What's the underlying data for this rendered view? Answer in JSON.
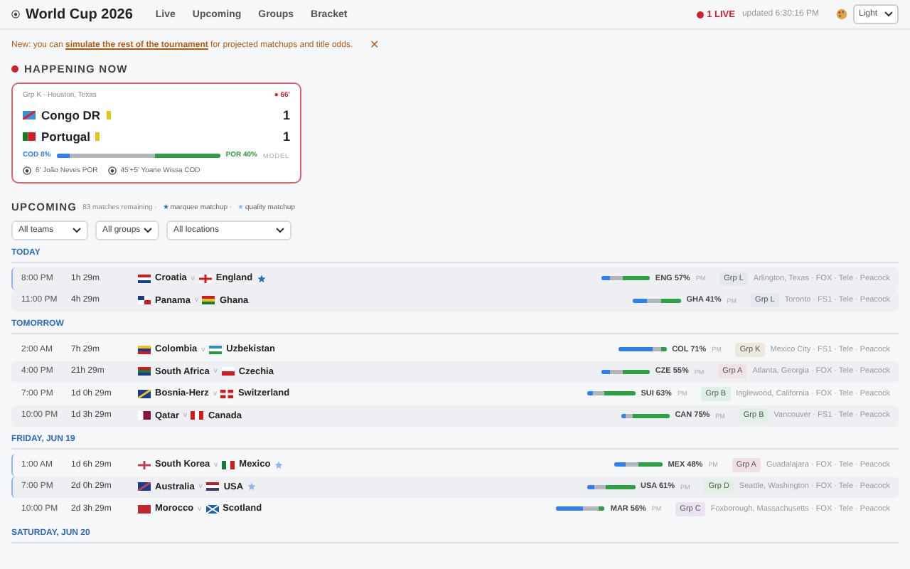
{
  "header": {
    "title": "World Cup 2026",
    "nav": [
      {
        "label": "Live",
        "selected": false
      },
      {
        "label": "Upcoming",
        "selected": false
      },
      {
        "label": "Groups",
        "selected": false
      },
      {
        "label": "Bracket",
        "selected": false
      }
    ],
    "live_count": "1 LIVE",
    "updated": "updated 6:30:16 PM",
    "theme": "Light"
  },
  "banner": {
    "text": "New: you can **simulate the rest of the tournament** for projected matchups and title odds.",
    "close": "✕"
  },
  "happening_now": {
    "title": "HAPPENING NOW",
    "match": {
      "info": "Grp K · Houston, Texas",
      "minute": "● 66'",
      "teams": [
        {
          "name": "Congo DR",
          "kind": "cd",
          "booked": true,
          "score": "1"
        },
        {
          "name": "Portugal",
          "kind": "pt",
          "booked": true,
          "score": "1"
        }
      ],
      "odds": {
        "home_label": "COD 8%",
        "away_label": "POR 40%",
        "home": {
          "level": 0.08
        },
        "away": {
          "level": 0.4
        },
        "model": "MODEL"
      },
      "events": [
        "6' João Neves POR",
        "45'+5' Yoane Wissa COD"
      ]
    }
  },
  "upcoming": {
    "title": "UPCOMING",
    "remaining": "83 matches remaining ·",
    "marquee": "★ marquee matchup ·",
    "quality": "★ quality matchup",
    "filters": [
      "All teams",
      "All groups",
      "All locations"
    ],
    "days": [
      {
        "label": "TODAY",
        "matches": [
          {
            "time": "8:00 PM",
            "countdown": "1h 29m",
            "home": {
              "name": "Croatia",
              "kind": "hr"
            },
            "versus": "v",
            "away": {
              "name": "England",
              "kind": "en"
            },
            "marquee": true,
            "quality": false,
            "odds": {
              "home": {
                "level": 0.18
              },
              "away": {
                "level": 0.57
              }
            },
            "pick": "ENG 57%",
            "pm": "PM",
            "group": {
              "label": "Grp L",
              "color": "#e3e8ee"
            },
            "venue": "Arlington, Texas · FOX · Tele · Peacock"
          },
          {
            "time": "11:00 PM",
            "countdown": "4h 29m",
            "home": {
              "name": "Panama",
              "kind": "pa"
            },
            "versus": "v",
            "away": {
              "name": "Ghana",
              "kind": "gh"
            },
            "marquee": false,
            "quality": false,
            "odds": {
              "home": {
                "level": 0.3
              },
              "away": {
                "level": 0.41
              }
            },
            "pick": "GHA 41%",
            "pm": "PM",
            "group": {
              "label": "Grp L",
              "color": "#e3e8ee"
            },
            "venue": "Toronto · FS1 · Tele · Peacock"
          }
        ]
      },
      {
        "label": "TOMORROW",
        "matches": [
          {
            "time": "2:00 AM",
            "countdown": "7h 29m",
            "home": {
              "name": "Colombia",
              "kind": "co"
            },
            "versus": "v",
            "away": {
              "name": "Uzbekistan",
              "kind": "uz"
            },
            "marquee": false,
            "quality": false,
            "odds": {
              "home": {
                "level": 0.71
              },
              "away": {
                "level": 0.1
              }
            },
            "pick": "COL 71%",
            "pm": "PM",
            "group": {
              "label": "Grp K",
              "color": "#ece9dc"
            },
            "venue": "Mexico City · FS1 · Tele · Peacock"
          },
          {
            "time": "4:00 PM",
            "countdown": "21h 29m",
            "home": {
              "name": "South Africa",
              "kind": "za"
            },
            "versus": "v",
            "away": {
              "name": "Czechia",
              "kind": "cz"
            },
            "marquee": false,
            "quality": false,
            "odds": {
              "home": {
                "level": 0.17
              },
              "away": {
                "level": 0.55
              }
            },
            "pick": "CZE 55%",
            "pm": "PM",
            "group": {
              "label": "Grp A",
              "color": "#f1e1e4"
            },
            "venue": "Atlanta, Georgia · FOX · Tele · Peacock"
          },
          {
            "time": "7:00 PM",
            "countdown": "1d 0h 29m",
            "home": {
              "name": "Bosnia-Herz",
              "kind": "ba"
            },
            "versus": "v",
            "away": {
              "name": "Switzerland",
              "kind": "ch"
            },
            "marquee": false,
            "quality": false,
            "odds": {
              "home": {
                "level": 0.12
              },
              "away": {
                "level": 0.63
              }
            },
            "pick": "SUI 63%",
            "pm": "PM",
            "group": {
              "label": "Grp B",
              "color": "#dff0e6"
            },
            "venue": "Inglewood, California · FOX · Tele · Peacock"
          },
          {
            "time": "10:00 PM",
            "countdown": "1d 3h 29m",
            "home": {
              "name": "Qatar",
              "kind": "qa"
            },
            "versus": "v",
            "away": {
              "name": "Canada",
              "kind": "ca"
            },
            "marquee": false,
            "quality": false,
            "odds": {
              "home": {
                "level": 0.1
              },
              "away": {
                "level": 0.75
              }
            },
            "pick": "CAN 75%",
            "pm": "PM",
            "group": {
              "label": "Grp B",
              "color": "#dff0e6"
            },
            "venue": "Vancouver · FS1 · Tele · Peacock"
          }
        ]
      },
      {
        "label": "FRIDAY, JUN 19",
        "matches": [
          {
            "time": "1:00 AM",
            "countdown": "1d 6h 29m",
            "home": {
              "name": "South Korea",
              "kind": "kr"
            },
            "versus": "v",
            "away": {
              "name": "Mexico",
              "kind": "mx"
            },
            "marquee": false,
            "quality": true,
            "odds": {
              "home": {
                "level": 0.25
              },
              "away": {
                "level": 0.48
              }
            },
            "pick": "MEX 48%",
            "pm": "PM",
            "group": {
              "label": "Grp A",
              "color": "#f1e1e4"
            },
            "venue": "Guadalajara · FOX · Tele · Peacock"
          },
          {
            "time": "7:00 PM",
            "countdown": "2d 0h 29m",
            "home": {
              "name": "Australia",
              "kind": "au"
            },
            "versus": "v",
            "away": {
              "name": "USA",
              "kind": "us"
            },
            "marquee": false,
            "quality": true,
            "odds": {
              "home": {
                "level": 0.17
              },
              "away": {
                "level": 0.61
              }
            },
            "pick": "USA 61%",
            "pm": "PM",
            "group": {
              "label": "Grp D",
              "color": "#e2f0e2"
            },
            "venue": "Seattle, Washington · FOX · Tele · Peacock"
          },
          {
            "time": "10:00 PM",
            "countdown": "2d 3h 29m",
            "home": {
              "name": "Morocco",
              "kind": "ma"
            },
            "versus": "v",
            "away": {
              "name": "Scotland",
              "kind": "sc"
            },
            "marquee": false,
            "quality": false,
            "odds": {
              "home": {
                "level": 0.56
              },
              "away": {
                "level": 0.14
              }
            },
            "pick": "MAR 56%",
            "pm": "PM",
            "group": {
              "label": "Grp C",
              "color": "#ece3f2"
            },
            "venue": "Foxborough, Massachusetts · FOX · Tele · Peacock"
          }
        ]
      },
      {
        "label": "SATURDAY, JUN 20"
      }
    ]
  }
}
